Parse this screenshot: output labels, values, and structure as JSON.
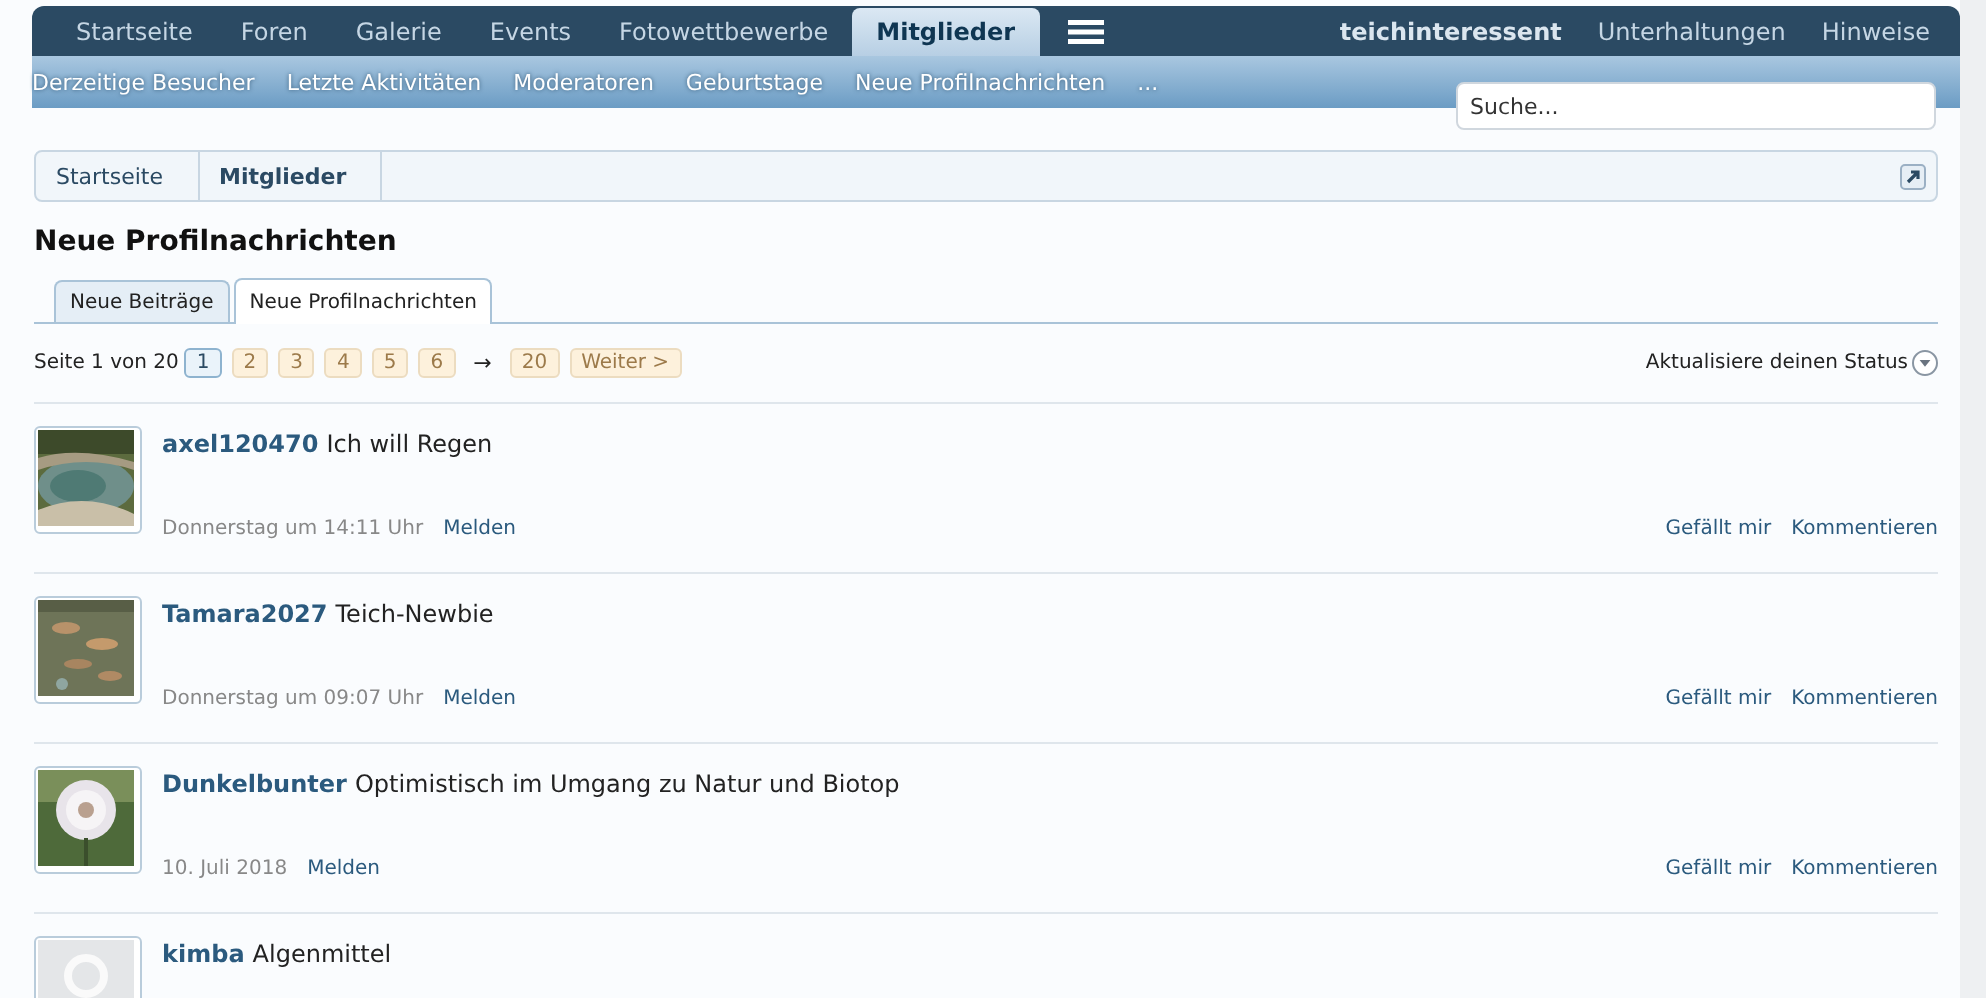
{
  "nav": {
    "tabs": [
      {
        "label": "Startseite",
        "selected": false
      },
      {
        "label": "Foren",
        "selected": false
      },
      {
        "label": "Galerie",
        "selected": false
      },
      {
        "label": "Events",
        "selected": false
      },
      {
        "label": "Fotowettbewerbe",
        "selected": false
      },
      {
        "label": "Mitglieder",
        "selected": true
      }
    ],
    "user_links": [
      {
        "label": "teichinteressent",
        "kind": "account"
      },
      {
        "label": "Unterhaltungen",
        "kind": "link"
      },
      {
        "label": "Hinweise",
        "kind": "link"
      }
    ]
  },
  "subnav": {
    "items": [
      "Derzeitige Besucher",
      "Letzte Aktivitäten",
      "Moderatoren",
      "Geburtstage",
      "Neue Profilnachrichten",
      "..."
    ]
  },
  "search": {
    "placeholder": "Suche..."
  },
  "breadcrumb": [
    "Startseite",
    "Mitglieder"
  ],
  "title": "Neue Profilnachrichten",
  "tabs": [
    {
      "label": "Neue Beiträge",
      "selected": false
    },
    {
      "label": "Neue Profilnachrichten",
      "selected": true
    }
  ],
  "pagination": {
    "label": "Seite 1 von 20",
    "pages": [
      {
        "label": "1",
        "selected": true
      },
      {
        "label": "2",
        "selected": false
      },
      {
        "label": "3",
        "selected": false
      },
      {
        "label": "4",
        "selected": false
      },
      {
        "label": "5",
        "selected": false
      },
      {
        "label": "6",
        "selected": false
      }
    ],
    "skip": "→",
    "last": "20",
    "next": "Weiter >"
  },
  "status_link": "Aktualisiere deinen Status",
  "messages": [
    {
      "user": "axel120470",
      "text": "Ich will Regen",
      "time": "Donnerstag um 14:11 Uhr",
      "report": "Melden",
      "actions": [
        "Gefällt mir",
        "Kommentieren"
      ],
      "avatar": {
        "kind": "picture"
      }
    },
    {
      "user": "Tamara2027",
      "text": "Teich-Newbie",
      "time": "Donnerstag um 09:07 Uhr",
      "report": "Melden",
      "actions": [
        "Gefällt mir",
        "Kommentieren"
      ],
      "avatar": {
        "kind": "picture"
      }
    },
    {
      "user": "Dunkelbunter",
      "text": "Optimistisch im Umgang zu Natur und Biotop",
      "time": "10. Juli 2018",
      "report": "Melden",
      "actions": [
        "Gefällt mir",
        "Kommentieren"
      ],
      "avatar": {
        "kind": "picture"
      }
    },
    {
      "user": "kimba",
      "text": "Algenmittel",
      "avatar": {
        "kind": "default"
      }
    }
  ]
}
